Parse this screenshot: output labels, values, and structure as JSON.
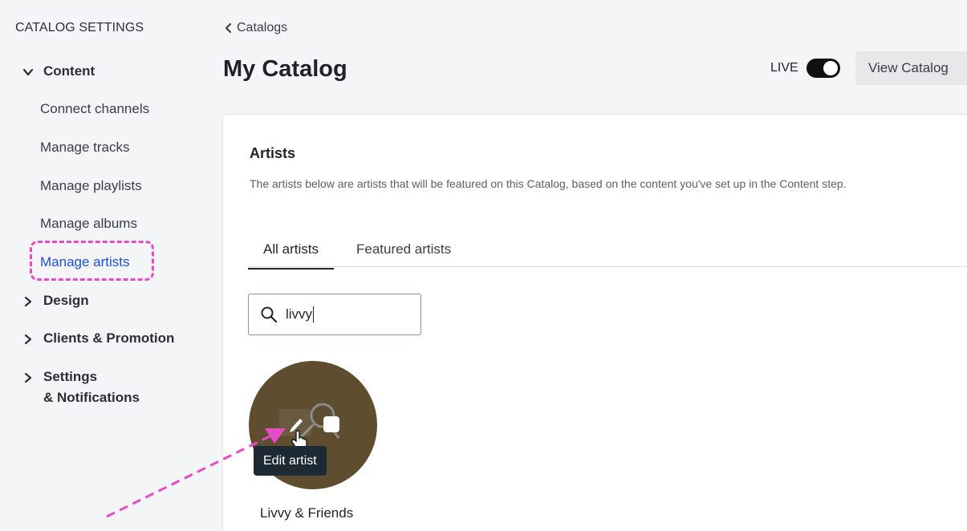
{
  "sidebar": {
    "header": "CATALOG SETTINGS",
    "sections": {
      "content": "Content",
      "design": "Design",
      "clients": "Clients & Promotion",
      "settings_line1": "Settings",
      "settings_line2": "& Notifications"
    },
    "items": {
      "connect_channels": "Connect channels",
      "manage_tracks": "Manage tracks",
      "manage_playlists": "Manage playlists",
      "manage_albums": "Manage albums",
      "manage_artists": "Manage artists"
    },
    "active_item": "Manage artists"
  },
  "header": {
    "breadcrumb": "Catalogs",
    "title": "My Catalog",
    "live_label": "LIVE",
    "live_on": true,
    "view_button": "View Catalog"
  },
  "artists": {
    "title": "Artists",
    "description": "The artists below are artists that will be featured on this Catalog, based on the content you've set up in the Content step.",
    "tabs": {
      "all": "All artists",
      "featured": "Featured artists"
    },
    "active_tab": "All artists",
    "search_value": "livvy",
    "results": [
      {
        "name": "Livvy & Friends",
        "tooltip": "Edit artist"
      }
    ]
  },
  "colors": {
    "accent": "#1d4fd8",
    "annotation": "#e64bc8",
    "avatar_bg": "#5e4d2f",
    "tooltip_bg": "#1d2933"
  }
}
